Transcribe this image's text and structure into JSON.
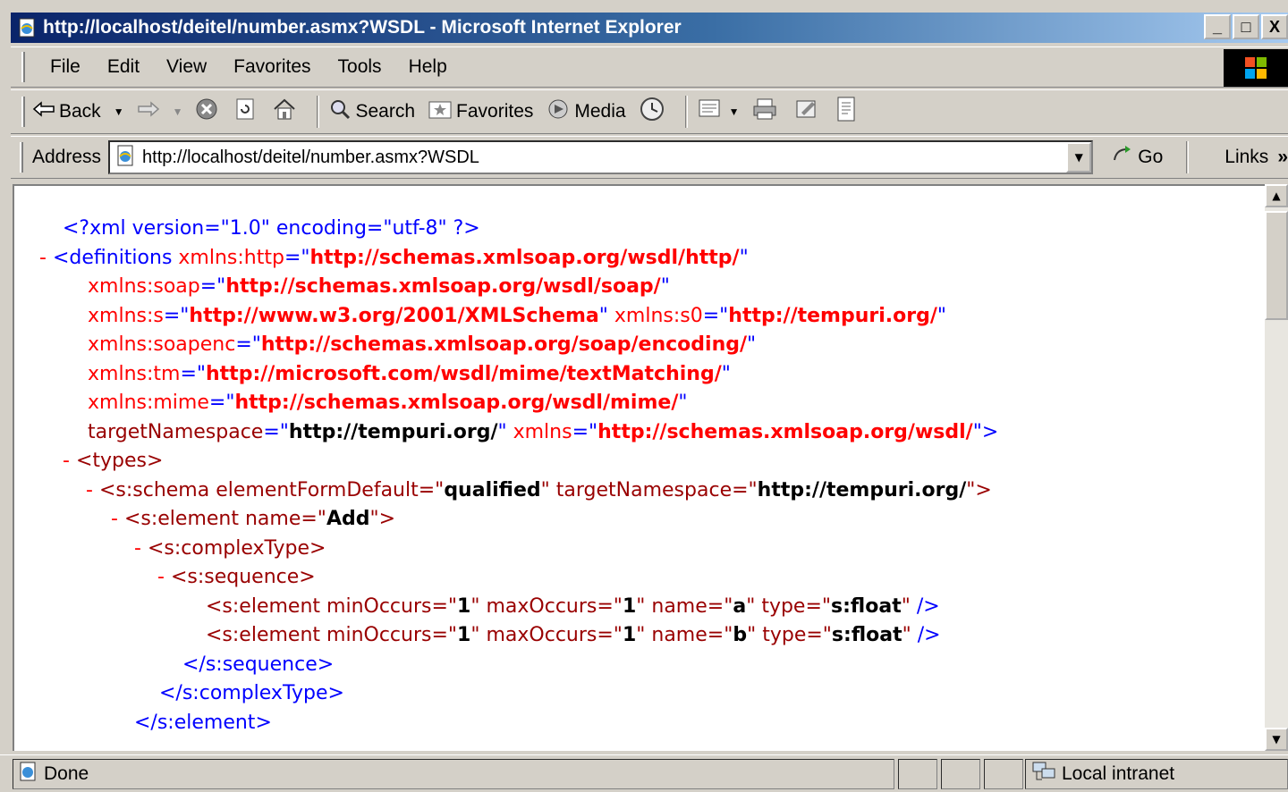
{
  "window": {
    "title": "http://localhost/deitel/number.asmx?WSDL - Microsoft Internet Explorer",
    "controls": {
      "minimize": "_",
      "maximize": "□",
      "close": "X"
    }
  },
  "menu": [
    "File",
    "Edit",
    "View",
    "Favorites",
    "Tools",
    "Help"
  ],
  "toolbar": {
    "back": "Back",
    "search": "Search",
    "favorites": "Favorites",
    "media": "Media"
  },
  "address": {
    "label": "Address",
    "url": "http://localhost/deitel/number.asmx?WSDL",
    "go": "Go",
    "links": "Links",
    "links_more": "»"
  },
  "xml": {
    "l1": "<?xml version=\"1.0\" encoding=\"utf-8\" ?>",
    "collapse": "-",
    "definitions_open": "<definitions",
    "xmlns_http": "xmlns:http",
    "xmlns_http_v": "http://schemas.xmlsoap.org/wsdl/http/",
    "xmlns_soap": "xmlns:soap",
    "xmlns_soap_v": "http://schemas.xmlsoap.org/wsdl/soap/",
    "xmlns_s": "xmlns:s",
    "xmlns_s_v": "http://www.w3.org/2001/XMLSchema",
    "xmlns_s0": "xmlns:s0",
    "xmlns_s0_v": "http://tempuri.org/",
    "xmlns_soapenc": "xmlns:soapenc",
    "xmlns_soapenc_v": "http://schemas.xmlsoap.org/soap/encoding/",
    "xmlns_tm": "xmlns:tm",
    "xmlns_tm_v": "http://microsoft.com/wsdl/mime/textMatching/",
    "xmlns_mime": "xmlns:mime",
    "xmlns_mime_v": "http://schemas.xmlsoap.org/wsdl/mime/",
    "targetNamespace": "targetNamespace",
    "targetNamespace_v": "http://tempuri.org/",
    "xmlns": "xmlns",
    "xmlns_v": "http://schemas.xmlsoap.org/wsdl/",
    "types": "<types>",
    "schema_open": "<s:schema",
    "elementFormDefault": "elementFormDefault",
    "elementFormDefault_v": "qualified",
    "schema_tns": "targetNamespace",
    "schema_tns_v": "http://tempuri.org/",
    "element_open": "<s:element",
    "name": "name",
    "name_v": "Add",
    "complexType": "<s:complexType>",
    "sequence": "<s:sequence>",
    "minOccurs": "minOccurs",
    "one": "1",
    "maxOccurs": "maxOccurs",
    "a": "a",
    "b": "b",
    "type": "type",
    "float": "s:float",
    "seq_close": "</s:sequence>",
    "ct_close": "</s:complexType>",
    "el_close": "</s:element>"
  },
  "status": {
    "text": "Done",
    "zone": "Local intranet"
  },
  "colors": {
    "titlebar_start": "#0a246a",
    "titlebar_end": "#a6caf0",
    "chrome": "#d4d0c8",
    "xml_markup": "#990000",
    "xml_namespace": "#ff0000",
    "xml_pi": "#0000ff"
  }
}
